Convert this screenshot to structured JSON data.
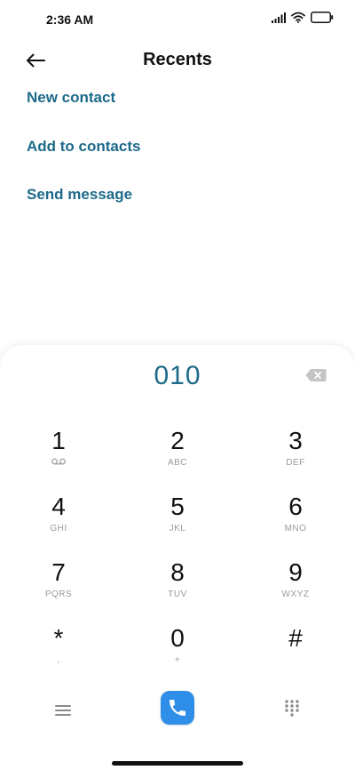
{
  "status_bar": {
    "time": "2:36 AM"
  },
  "header": {
    "title": "Recents"
  },
  "actions": [
    {
      "label": "New contact"
    },
    {
      "label": "Add to contacts"
    },
    {
      "label": "Send message"
    }
  ],
  "dialer": {
    "number": "010",
    "keys": [
      {
        "digit": "1",
        "sub": ""
      },
      {
        "digit": "2",
        "sub": "ABC"
      },
      {
        "digit": "3",
        "sub": "DEF"
      },
      {
        "digit": "4",
        "sub": "GHI"
      },
      {
        "digit": "5",
        "sub": "JKL"
      },
      {
        "digit": "6",
        "sub": "MNO"
      },
      {
        "digit": "7",
        "sub": "PQRS"
      },
      {
        "digit": "8",
        "sub": "TUV"
      },
      {
        "digit": "9",
        "sub": "WXYZ"
      },
      {
        "digit": "*",
        "sub": ","
      },
      {
        "digit": "0",
        "sub": "+"
      },
      {
        "digit": "#",
        "sub": ""
      }
    ]
  },
  "icons": {
    "back": "arrow-left-icon",
    "signal": "signal-icon",
    "wifi": "wifi-icon",
    "battery": "battery-icon",
    "backspace": "backspace-icon",
    "voicemail": "voicemail-icon",
    "menu": "menu-icon",
    "call": "phone-icon",
    "keypad": "keypad-icon"
  },
  "colors": {
    "accent": "#1d6a8a",
    "call_button": "#2f8ee8"
  }
}
